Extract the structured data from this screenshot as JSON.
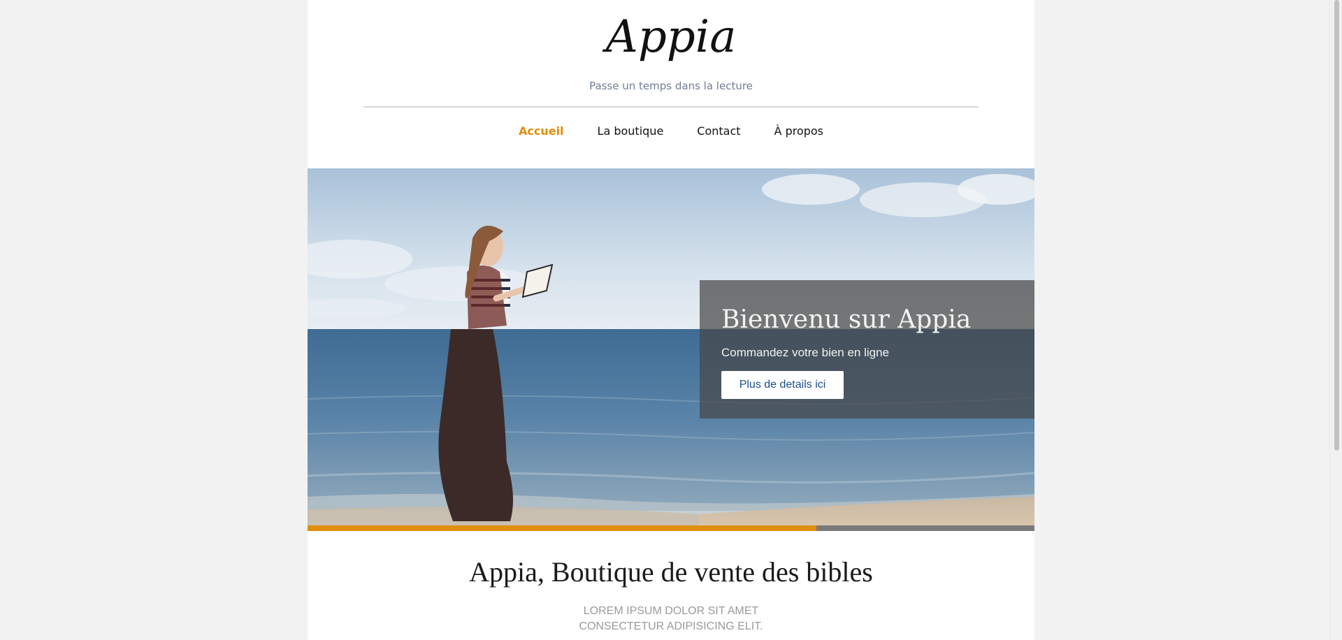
{
  "header": {
    "logo_text": "Appia",
    "tagline": "Passe un temps dans la lecture"
  },
  "nav": {
    "items": [
      {
        "label": "Accueil",
        "active": true
      },
      {
        "label": "La boutique",
        "active": false
      },
      {
        "label": "Contact",
        "active": false
      },
      {
        "label": "À propos",
        "active": false
      }
    ]
  },
  "hero": {
    "title": "Bienvenu sur Appia",
    "subtitle": "Commandez votre bien en ligne",
    "button_label": "Plus de details ici",
    "slide_progress": 0.7
  },
  "intro": {
    "title": "Appia, Boutique de vente des bibles",
    "line1": "LOREM IPSUM DOLOR SIT AMET",
    "line2": "CONSECTETUR ADIPISICING ELIT."
  },
  "colors": {
    "accent": "#e08e0b",
    "page_background": "#f2f2f2",
    "tagline": "#6f7d96",
    "button_text": "#1b4e8d"
  }
}
